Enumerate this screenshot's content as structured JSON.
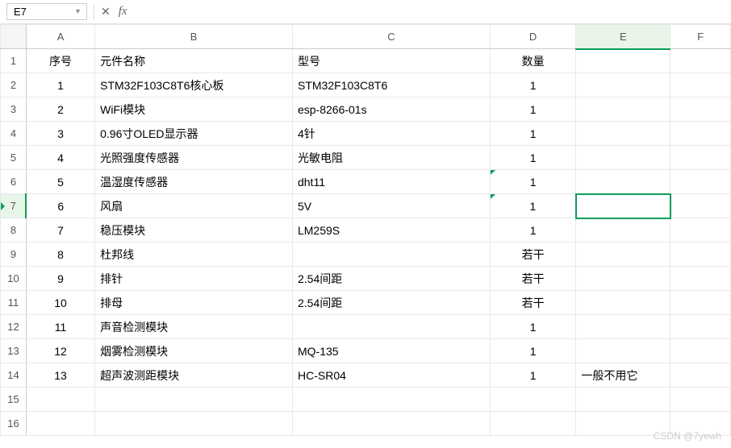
{
  "toolbar": {
    "name_box": "E7",
    "fx_label": "fx"
  },
  "columns": [
    "A",
    "B",
    "C",
    "D",
    "E",
    "F"
  ],
  "headers": {
    "A": "序号",
    "B": "元件名称",
    "C": "型号",
    "D": "数量",
    "E": "",
    "F": ""
  },
  "rows": [
    {
      "n": "1",
      "name": "STM32F103C8T6核心板",
      "model": "STM32F103C8T6",
      "qty": "1",
      "e": ""
    },
    {
      "n": "2",
      "name": "WiFi模块",
      "model": "esp-8266-01s",
      "qty": "1",
      "e": ""
    },
    {
      "n": "3",
      "name": "0.96寸OLED显示器",
      "model": "4针",
      "qty": "1",
      "e": ""
    },
    {
      "n": "4",
      "name": "光照强度传感器",
      "model": "光敏电阻",
      "qty": "1",
      "e": ""
    },
    {
      "n": "5",
      "name": "温湿度传感器",
      "model": "dht11",
      "qty": "1",
      "e": ""
    },
    {
      "n": "6",
      "name": "风扇",
      "model": "5V",
      "qty": "1",
      "e": ""
    },
    {
      "n": "7",
      "name": "稳压模块",
      "model": "LM259S",
      "qty": "1",
      "e": ""
    },
    {
      "n": "8",
      "name": "杜邦线",
      "model": "",
      "qty": "若干",
      "e": ""
    },
    {
      "n": "9",
      "name": "排针",
      "model": "2.54间距",
      "qty": "若干",
      "e": ""
    },
    {
      "n": "10",
      "name": "排母",
      "model": "2.54间距",
      "qty": "若干",
      "e": ""
    },
    {
      "n": "11",
      "name": "声音检测模块",
      "model": "",
      "qty": "1",
      "e": ""
    },
    {
      "n": "12",
      "name": "烟雾检测模块",
      "model": "MQ-135",
      "qty": "1",
      "e": ""
    },
    {
      "n": "13",
      "name": "超声波测距模块",
      "model": "HC-SR04",
      "qty": "1",
      "e": "一般不用它"
    }
  ],
  "selected_cell": "E7",
  "watermark": "CSDN @7yewh"
}
